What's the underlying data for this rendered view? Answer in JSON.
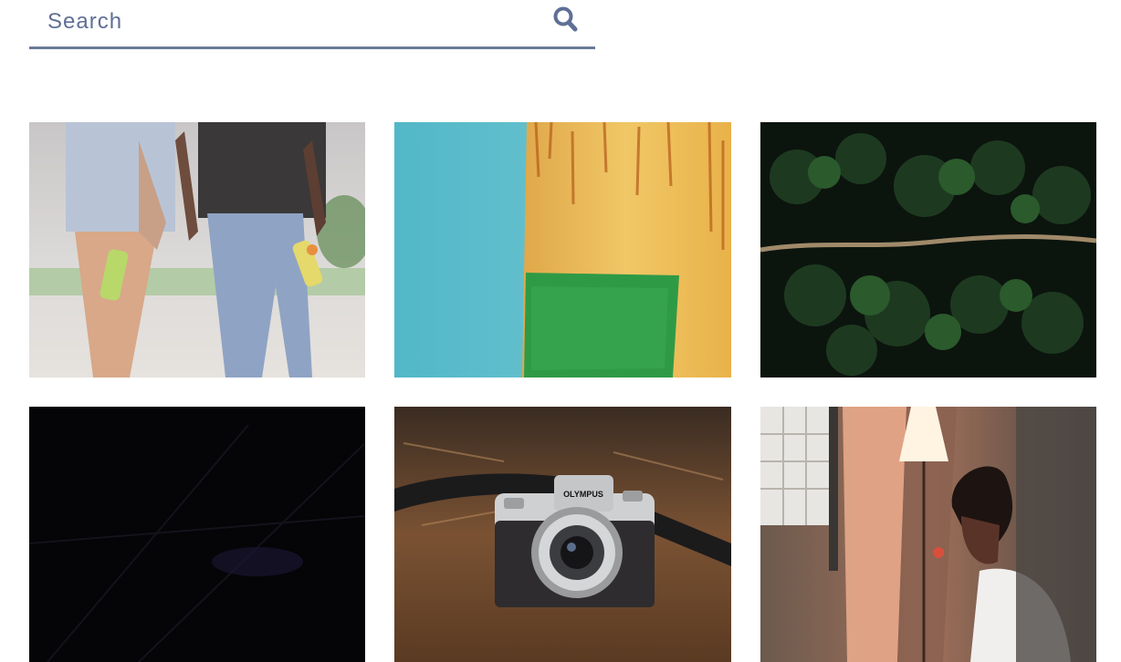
{
  "search": {
    "placeholder": "Search",
    "value": "",
    "icon": "search-icon",
    "color": "#5f6f95"
  },
  "gallery": {
    "photos": [
      {
        "id": "photo-1",
        "subject": "people-with-drinks"
      },
      {
        "id": "photo-2",
        "subject": "painted-wall"
      },
      {
        "id": "photo-3",
        "subject": "forest-aerial"
      },
      {
        "id": "photo-4",
        "subject": "dark-abstract"
      },
      {
        "id": "photo-5",
        "subject": "camera",
        "caption_text": "OLYMPUS"
      },
      {
        "id": "photo-6",
        "subject": "man-by-lamp"
      }
    ]
  }
}
